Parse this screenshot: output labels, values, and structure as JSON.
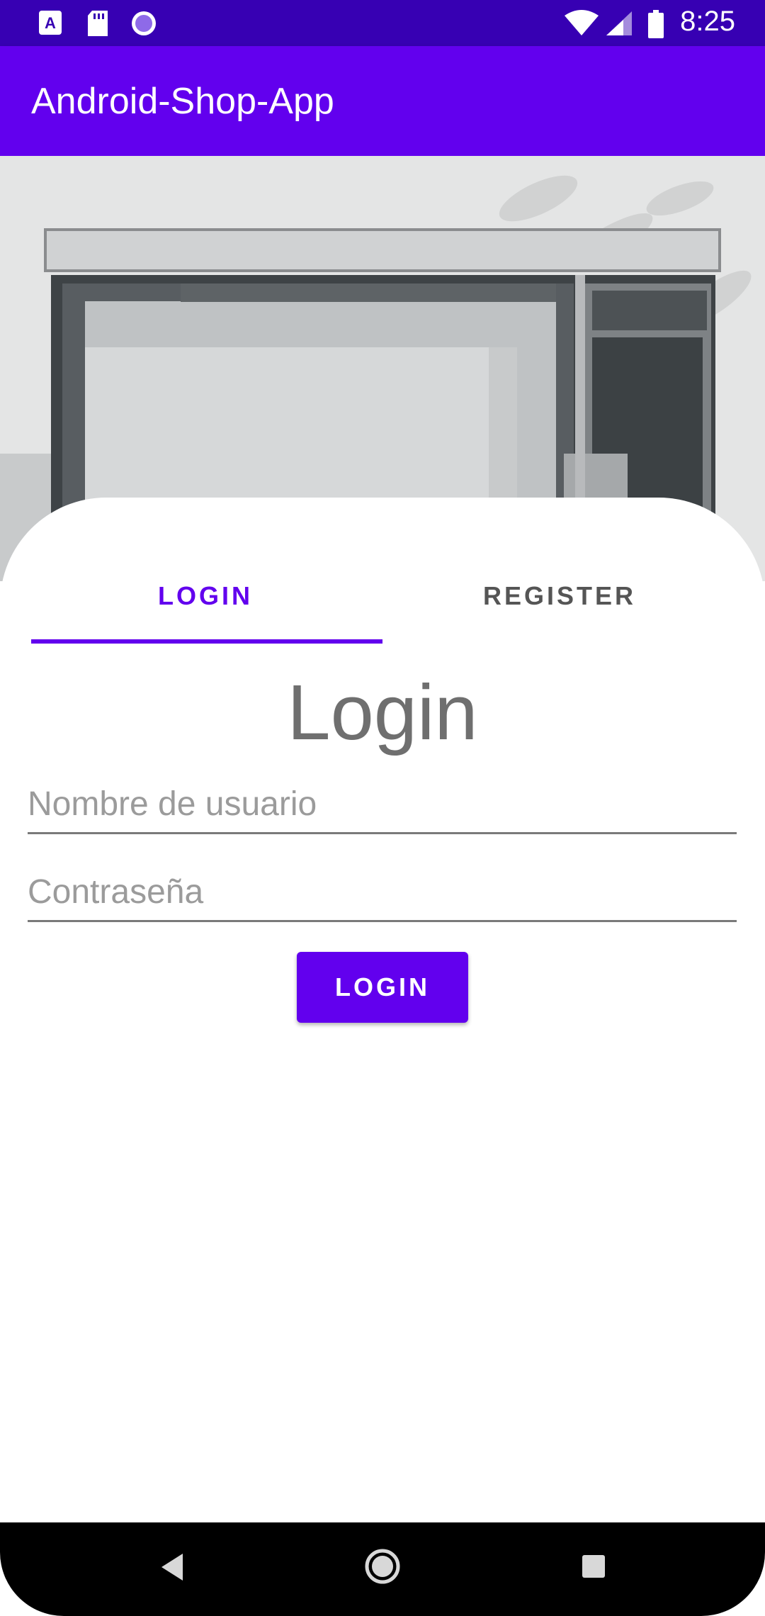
{
  "status_bar": {
    "time": "8:25",
    "icons": [
      "a-notification-icon",
      "sd-card-icon",
      "sync-icon",
      "wifi-icon",
      "signal-icon",
      "battery-icon"
    ]
  },
  "app_bar": {
    "title": "Android-Shop-App",
    "color": "#6200ee"
  },
  "tabs": [
    {
      "label": "LOGIN",
      "selected": true
    },
    {
      "label": "REGISTER",
      "selected": false
    }
  ],
  "form": {
    "title": "Login",
    "username": {
      "value": "",
      "placeholder": "Nombre de usuario"
    },
    "password": {
      "value": "",
      "placeholder": "Contraseña"
    },
    "submit_label": "LOGIN"
  },
  "colors": {
    "primary": "#6200ee",
    "primary_dark": "#3700b3"
  },
  "nav_bar": {
    "icons": [
      "back-icon",
      "home-icon",
      "recents-icon"
    ]
  }
}
